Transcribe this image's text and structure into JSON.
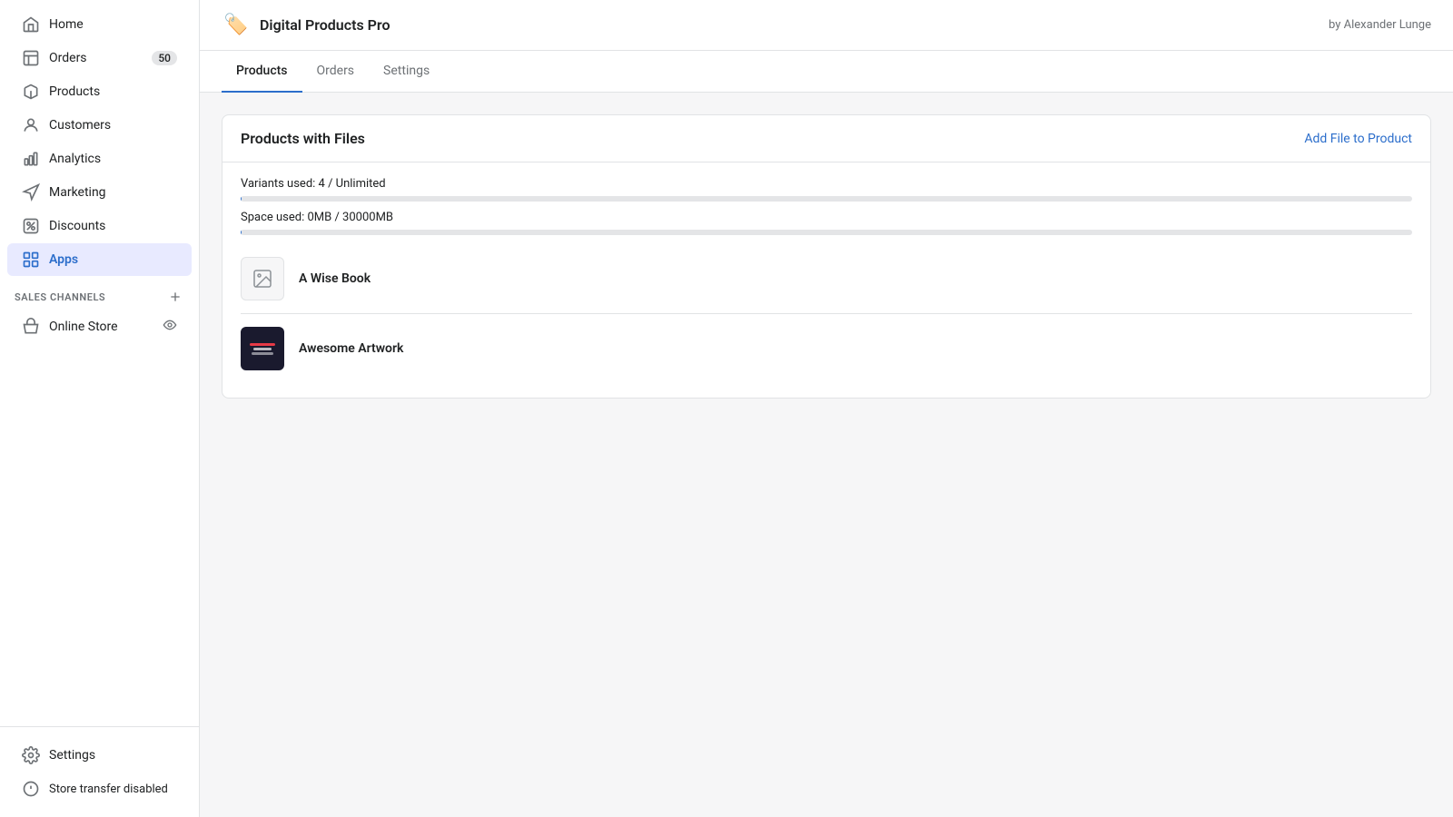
{
  "sidebar": {
    "items": [
      {
        "id": "home",
        "label": "Home",
        "icon": "home",
        "active": false
      },
      {
        "id": "orders",
        "label": "Orders",
        "icon": "orders",
        "active": false,
        "badge": "50"
      },
      {
        "id": "products",
        "label": "Products",
        "icon": "products",
        "active": false
      },
      {
        "id": "customers",
        "label": "Customers",
        "icon": "customers",
        "active": false
      },
      {
        "id": "analytics",
        "label": "Analytics",
        "icon": "analytics",
        "active": false
      },
      {
        "id": "marketing",
        "label": "Marketing",
        "icon": "marketing",
        "active": false
      },
      {
        "id": "discounts",
        "label": "Discounts",
        "icon": "discounts",
        "active": false
      },
      {
        "id": "apps",
        "label": "Apps",
        "icon": "apps",
        "active": true
      }
    ],
    "sections": [
      {
        "title": "SALES CHANNELS",
        "items": [
          {
            "id": "online-store",
            "label": "Online Store",
            "icon": "store"
          }
        ]
      }
    ],
    "bottom": [
      {
        "id": "settings",
        "label": "Settings",
        "icon": "settings"
      },
      {
        "id": "store-transfer",
        "label": "Store transfer disabled",
        "icon": "info"
      }
    ]
  },
  "app": {
    "icon": "🏷️",
    "title": "Digital Products Pro",
    "byline": "by Alexander Lunge"
  },
  "tabs": [
    {
      "id": "products",
      "label": "Products",
      "active": true
    },
    {
      "id": "orders",
      "label": "Orders",
      "active": false
    },
    {
      "id": "settings",
      "label": "Settings",
      "active": false
    }
  ],
  "card": {
    "title": "Products with Files",
    "add_file_label": "Add File to Product",
    "variants_label": "Variants used: 4 / Unlimited",
    "space_label": "Space used: 0MB / 30000MB",
    "variants_percent": 0,
    "space_percent": 0,
    "products": [
      {
        "id": "wise-book",
        "name": "A Wise Book",
        "has_image": false
      },
      {
        "id": "awesome-artwork",
        "name": "Awesome Artwork",
        "has_image": true
      }
    ]
  }
}
